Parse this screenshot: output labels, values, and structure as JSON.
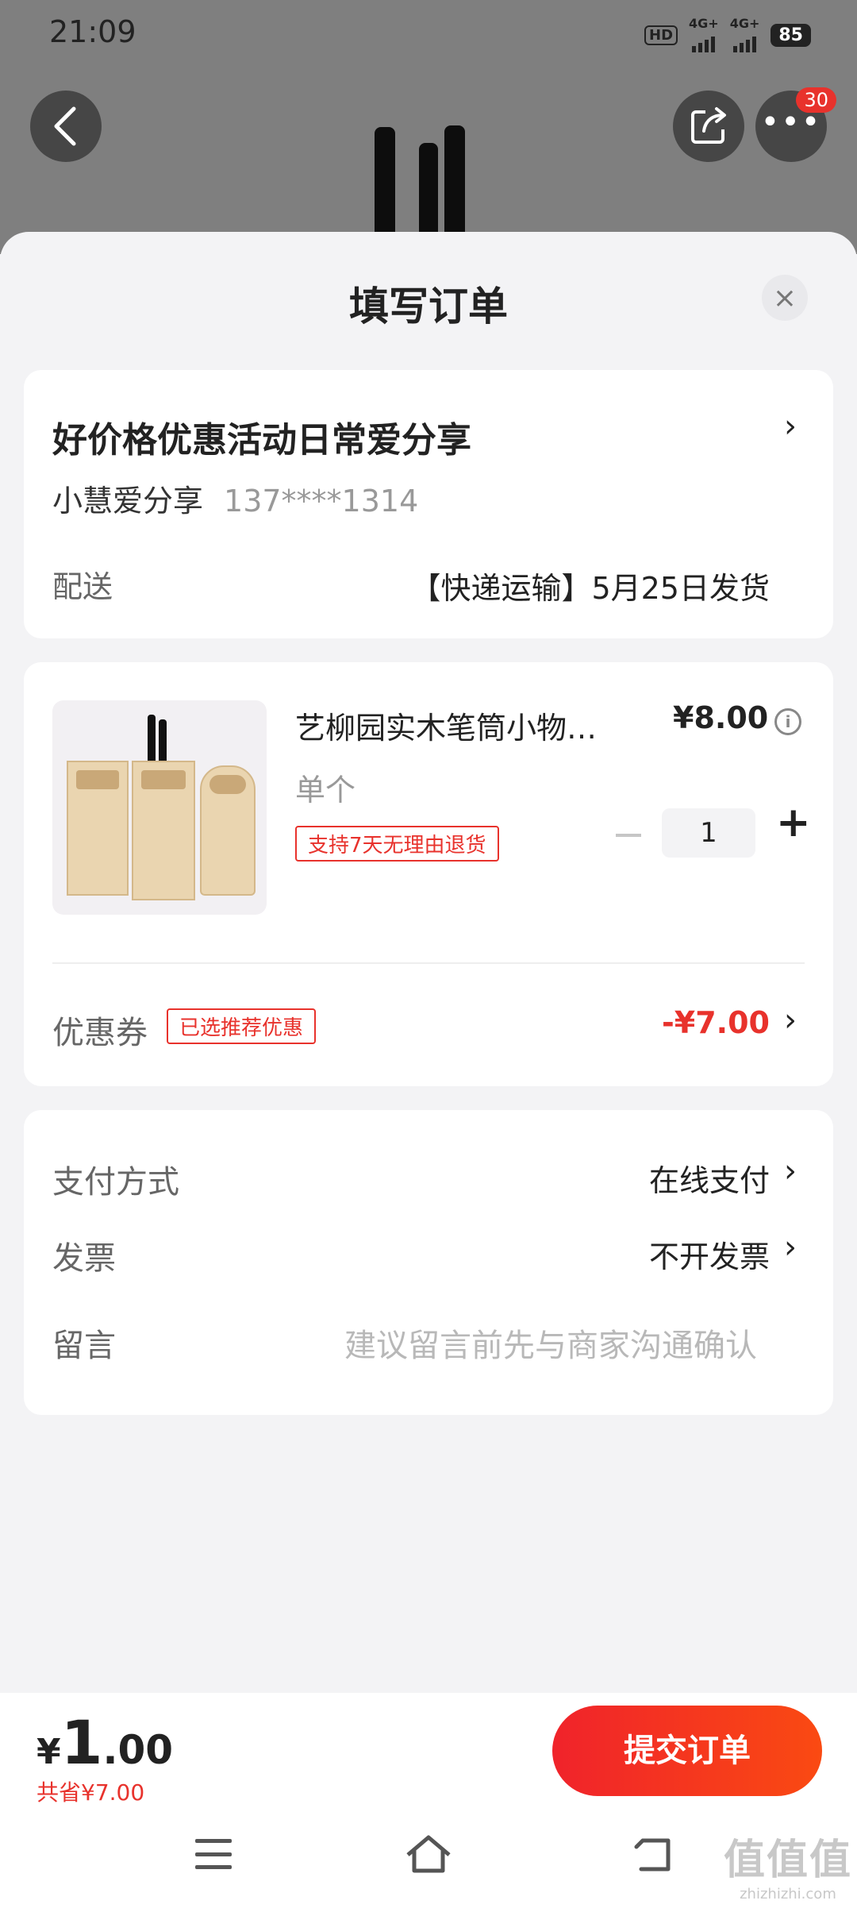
{
  "status_bar": {
    "time": "21:09",
    "network1": "4G+",
    "network2": "4G+",
    "hd_label": "HD",
    "battery": "85"
  },
  "top_nav": {
    "more_badge": "30"
  },
  "sheet": {
    "title": "填写订单",
    "close_label": "×"
  },
  "address": {
    "line1": "好价格优惠活动日常爱分享",
    "name": "小慧爱分享",
    "phone": "137****1314",
    "delivery_label": "配送",
    "delivery_value": "【快递运输】5月25日发货"
  },
  "product": {
    "name": "艺柳园实木笔筒小物…",
    "price": "¥8.00",
    "spec": "单个",
    "return_tag": "支持7天无理由退货",
    "quantity": "1"
  },
  "coupon": {
    "label": "优惠券",
    "tag": "已选推荐优惠",
    "value": "-¥7.00"
  },
  "payment": {
    "method_label": "支付方式",
    "method_value": "在线支付",
    "invoice_label": "发票",
    "invoice_value": "不开发票",
    "message_label": "留言",
    "message_placeholder": "建议留言前先与商家沟通确认"
  },
  "checkout": {
    "currency": "¥",
    "amount_int": "1",
    "amount_dec": ".00",
    "saved": "共省¥7.00",
    "submit_label": "提交订单"
  },
  "watermark": {
    "logo": "值值值",
    "url": "zhizhizhi.com"
  },
  "colors": {
    "accent": "#e8322c",
    "button_gradient_start": "#f0232b",
    "button_gradient_end": "#fa4a12",
    "background": "#f3f3f5"
  }
}
